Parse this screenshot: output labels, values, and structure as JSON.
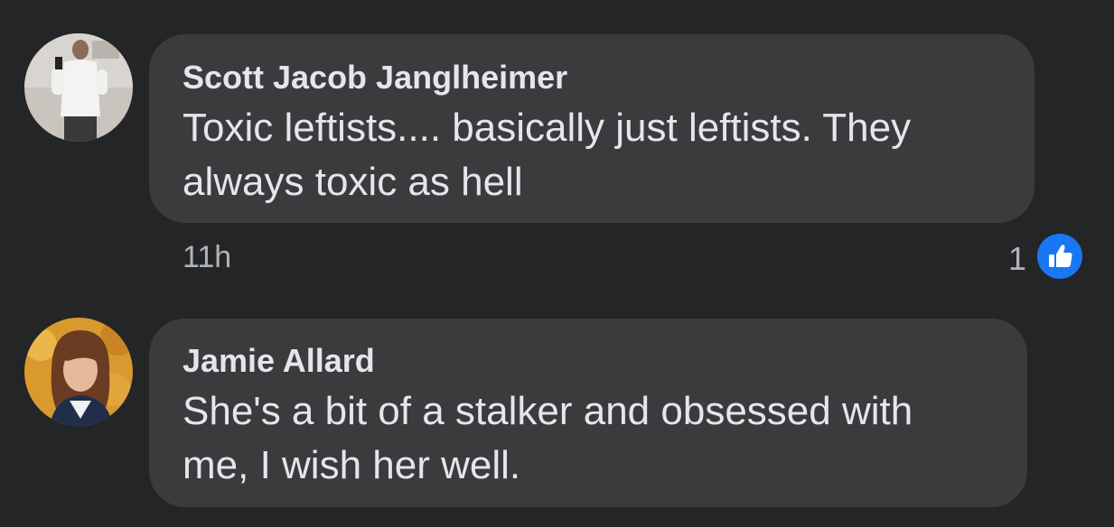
{
  "comments": [
    {
      "author": "Scott Jacob Janglheimer",
      "text_lines": [
        "Toxic leftists.... basically just leftists. They",
        "always toxic as hell"
      ],
      "time": "11h",
      "reaction_count": "1",
      "reaction_icon": "like-icon"
    },
    {
      "author": "Jamie Allard",
      "text_lines": [
        "She's a bit of a stalker and obsessed with",
        "me, I wish her well."
      ]
    }
  ],
  "colors": {
    "background": "#242526",
    "bubble": "#3a3b3c",
    "text": "#e4e6eb",
    "meta": "#b0b3b8",
    "like": "#1877f2"
  }
}
